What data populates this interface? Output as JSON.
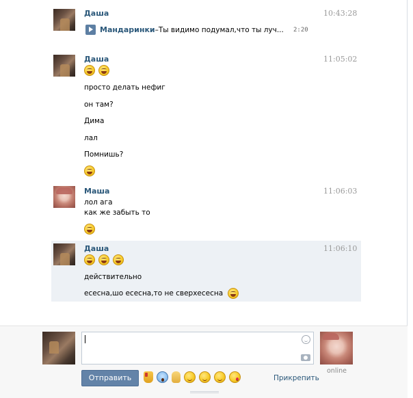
{
  "messages": [
    {
      "author": "Даша",
      "time": "10:43:28",
      "audio": {
        "artist": "Мандаринки",
        "separator": " – ",
        "title": "Ты видимо подумал,что ты луч...",
        "duration": "2:20"
      }
    },
    {
      "author": "Даша",
      "time": "11:05:02",
      "lines": [
        "просто делать нефиг",
        "он там?",
        "Дима",
        "лал",
        "Помнишь?"
      ]
    },
    {
      "author": "Маша",
      "time": "11:06:03",
      "lines": [
        "лол ага",
        "как же забыть то"
      ]
    },
    {
      "author": "Даша",
      "time": "11:06:10",
      "lines": [
        "действительно",
        "есесна,шо есесна,то не сверхесесна"
      ]
    }
  ],
  "compose": {
    "message_value": "",
    "send_label": "Отправить",
    "attach_label": "Прикрепить",
    "peer_status": "online",
    "quick_emoji": [
      "thumbs-down",
      "screaming-face",
      "victory-hand",
      "relieved-face",
      "tears-of-joy",
      "smirk-face",
      "kissing-wink"
    ]
  },
  "colors": {
    "author_link": "#2b587a",
    "send_button": "#6383a8",
    "highlight_row": "#edf1f5",
    "timestamp": "#999999"
  }
}
